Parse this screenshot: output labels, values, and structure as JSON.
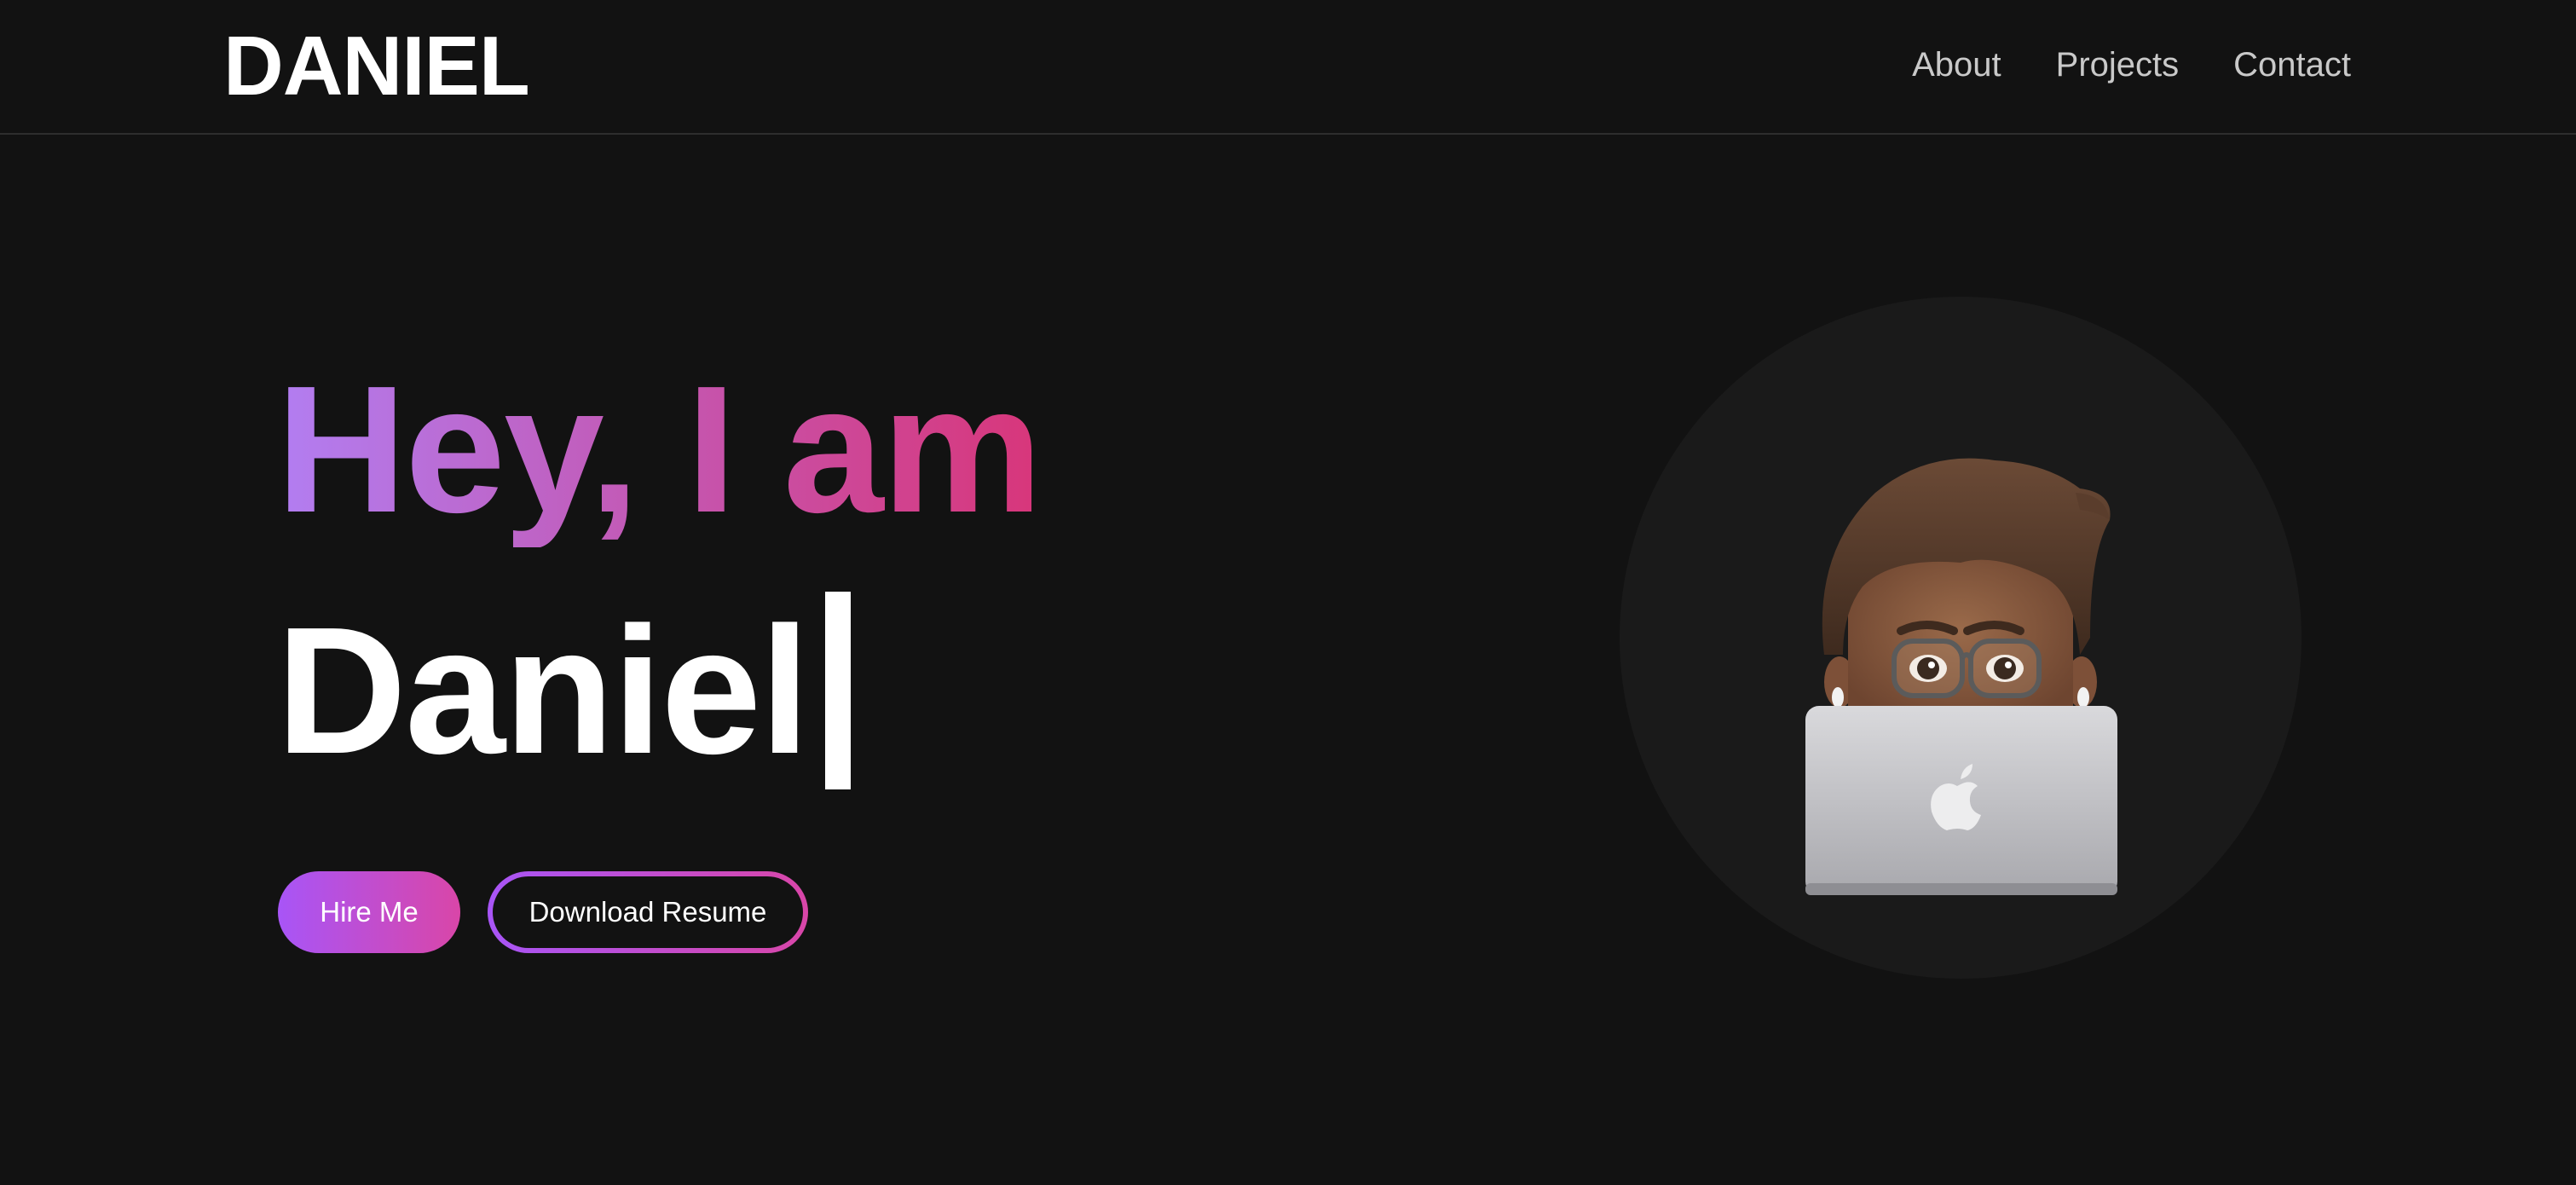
{
  "header": {
    "logo": "DANIEL",
    "nav": [
      {
        "label": "About"
      },
      {
        "label": "Projects"
      },
      {
        "label": "Contact"
      }
    ]
  },
  "hero": {
    "greeting": "Hey, I am",
    "name": "Daniel",
    "hire_button": "Hire Me",
    "resume_button": "Download Resume"
  },
  "colors": {
    "background": "#121212",
    "gradient_start": "#a855f7",
    "gradient_end": "#d946a8",
    "text": "#ffffff",
    "nav_text": "#c9c9c9"
  },
  "avatar": {
    "icon": "memoji-with-laptop-icon"
  }
}
